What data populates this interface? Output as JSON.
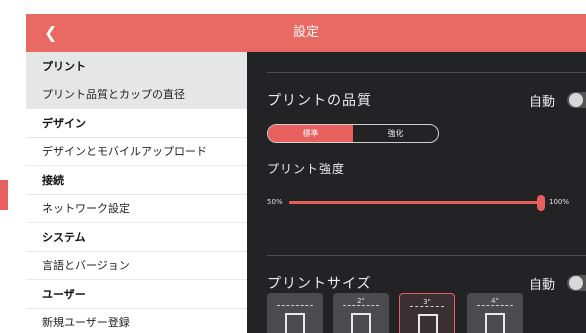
{
  "header": {
    "title": "設定",
    "back_icon": "chevron-left-icon"
  },
  "sidebar": {
    "sections": [
      {
        "heading": "プリント",
        "item": "プリント品質とカップの直径"
      },
      {
        "heading": "デザイン",
        "item": "デザインとモバイルアップロード"
      },
      {
        "heading": "接続",
        "item": "ネットワーク設定"
      },
      {
        "heading": "システム",
        "item": "言語とバージョン"
      },
      {
        "heading": "ユーザー",
        "item": "新規ユーザー登録"
      }
    ]
  },
  "quality": {
    "title": "プリントの品質",
    "auto_label": "自動",
    "auto_on": false,
    "options": [
      "標準",
      "強化"
    ],
    "selected": "標準"
  },
  "strength": {
    "title": "プリント強度",
    "min_label": "50%",
    "max_label": "100%",
    "value_percent": 100
  },
  "size": {
    "title": "プリントサイズ",
    "auto_label": "自動",
    "auto_on": false,
    "cups": [
      {
        "label": "",
        "icon": "edit-cup-icon"
      },
      {
        "label": "2\"",
        "icon": "cup-icon"
      },
      {
        "label": "3\"",
        "icon": "cup-icon"
      },
      {
        "label": "4\"",
        "icon": "cup-icon"
      }
    ],
    "selected_index": 2
  },
  "colors": {
    "accent": "#e8605e",
    "header": "#e86a63",
    "panel": "#232326"
  }
}
